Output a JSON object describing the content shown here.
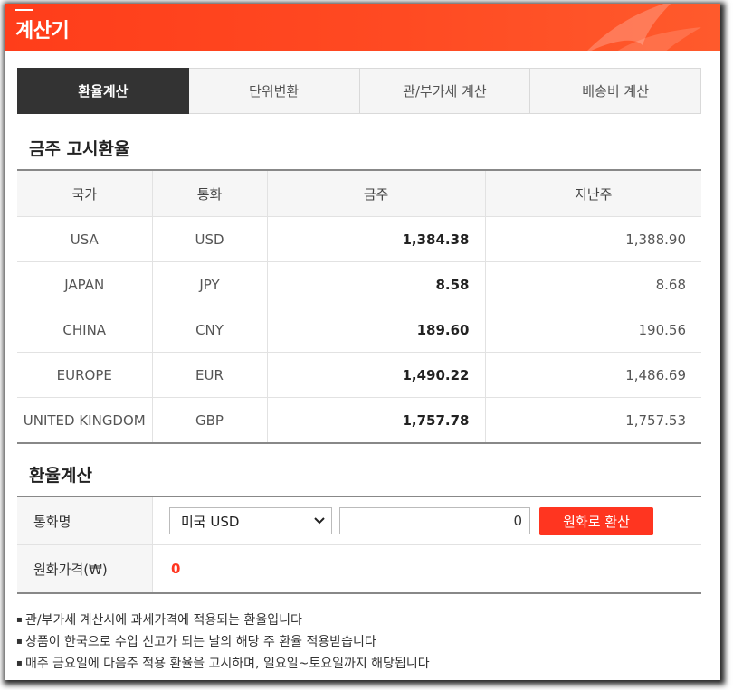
{
  "window": {
    "title": "계산기"
  },
  "tabs": [
    {
      "label": "환율계산",
      "active": true
    },
    {
      "label": "단위변환",
      "active": false
    },
    {
      "label": "관/부가세 계산",
      "active": false
    },
    {
      "label": "배송비 계산",
      "active": false
    }
  ],
  "rates": {
    "title": "금주 고시환율",
    "columns": [
      "국가",
      "통화",
      "금주",
      "지난주"
    ],
    "rows": [
      {
        "country": "USA",
        "currency": "USD",
        "this_week": "1,384.38",
        "last_week": "1,388.90"
      },
      {
        "country": "JAPAN",
        "currency": "JPY",
        "this_week": "8.58",
        "last_week": "8.68"
      },
      {
        "country": "CHINA",
        "currency": "CNY",
        "this_week": "189.60",
        "last_week": "190.56"
      },
      {
        "country": "EUROPE",
        "currency": "EUR",
        "this_week": "1,490.22",
        "last_week": "1,486.69"
      },
      {
        "country": "UNITED KINGDOM",
        "currency": "GBP",
        "this_week": "1,757.78",
        "last_week": "1,757.53"
      }
    ]
  },
  "calculator": {
    "title": "환율계산",
    "currency_label": "통화명",
    "currency_selected": "미국 USD",
    "amount_value": "0",
    "convert_button": "원화로 환산",
    "krw_label": "원화가격(₩)",
    "krw_value": "0"
  },
  "notes": [
    "관/부가세 계산시에 과세가격에 적용되는 환율입니다",
    "상품이 한국으로 수입 신고가 되는 날의 해당 주 환율 적용받습니다",
    "매주 금요일에 다음주 적용 환율을 고시하며, 일요일~토요일까지 해당됩니다"
  ],
  "colors": {
    "accent": "#ff3520",
    "titlebar": "#ff4a22",
    "active_tab": "#333333"
  },
  "icons": {
    "select_arrow": "chevron-down-icon",
    "title_decoration": "bird-watermark-icon"
  }
}
